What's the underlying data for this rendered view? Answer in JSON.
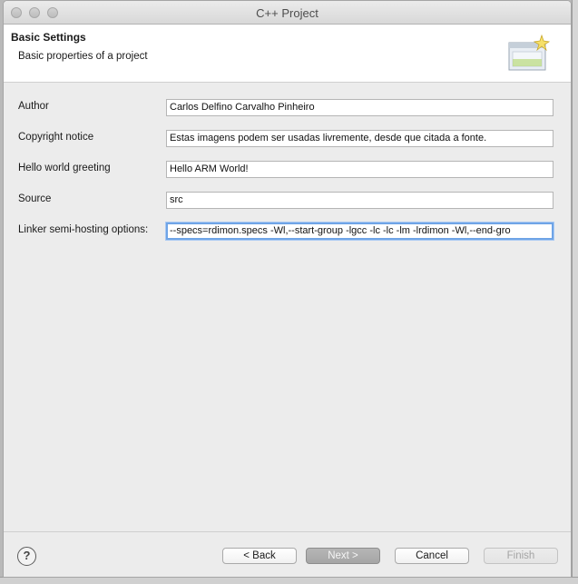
{
  "window": {
    "title": "C++ Project"
  },
  "header": {
    "title": "Basic Settings",
    "subtitle": "Basic properties of a project"
  },
  "form": {
    "author_label": "Author",
    "author_value": "Carlos Delfino Carvalho Pinheiro",
    "copyright_label": "Copyright notice",
    "copyright_value": "Estas imagens podem ser usadas livremente, desde que citada a fonte.",
    "greeting_label": "Hello world greeting",
    "greeting_value": "Hello ARM World!",
    "source_label": "Source",
    "source_value": "src",
    "linker_label": "Linker semi-hosting options:",
    "linker_value": "--specs=rdimon.specs -Wl,--start-group -lgcc -lc -lc -lm -lrdimon -Wl,--end-gro"
  },
  "footer": {
    "help_glyph": "?",
    "back_label": "< Back",
    "next_label": "Next >",
    "cancel_label": "Cancel",
    "finish_label": "Finish"
  }
}
